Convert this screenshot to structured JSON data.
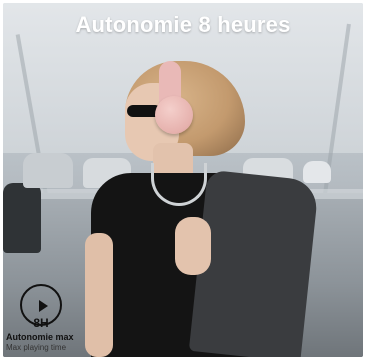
{
  "title": "Autonomie 8 heures",
  "badge": {
    "value": "8H",
    "label": "Autonomie max",
    "sublabel": "Max playing time",
    "icon": "play-icon"
  },
  "colors": {
    "title_text": "#ffffff",
    "badge_text": "#111111",
    "headphones": "#e9b9b7"
  }
}
